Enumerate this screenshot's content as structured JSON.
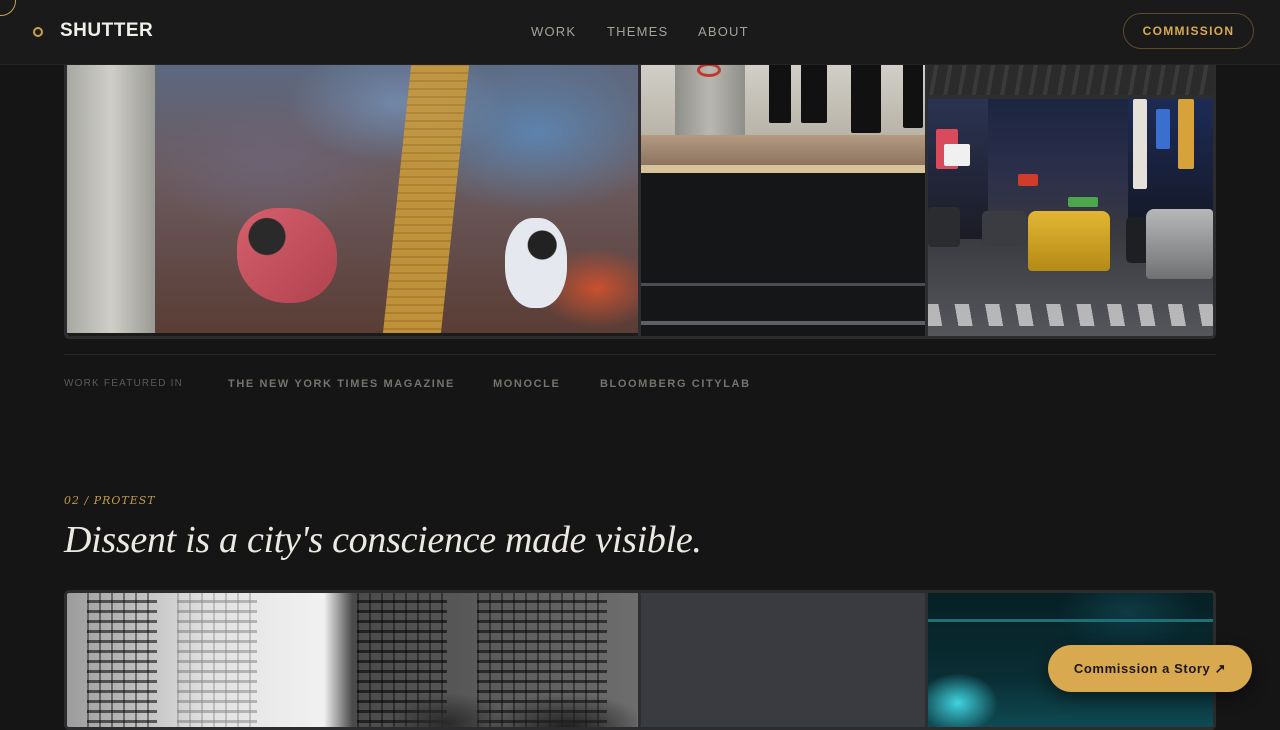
{
  "header": {
    "brand": "SHUTTER",
    "nav": [
      "WORK",
      "THEMES",
      "ABOUT"
    ],
    "commission_label": "COMMISSION"
  },
  "featured": {
    "label": "WORK FEATURED IN",
    "publications": [
      "THE NEW YORK TIMES MAGAZINE",
      "MONOCLE",
      "BLOOMBERG CITYLAB"
    ]
  },
  "section": {
    "kicker": "02 / PROTEST",
    "title": "Dissent is a city's conscience made visible."
  },
  "cta": {
    "label": "Commission a Story ↗"
  },
  "colors": {
    "accent": "#d8a94f",
    "background": "#151515",
    "text": "#e8e6e1"
  },
  "icons": {
    "logo": "ring-dot-icon"
  }
}
